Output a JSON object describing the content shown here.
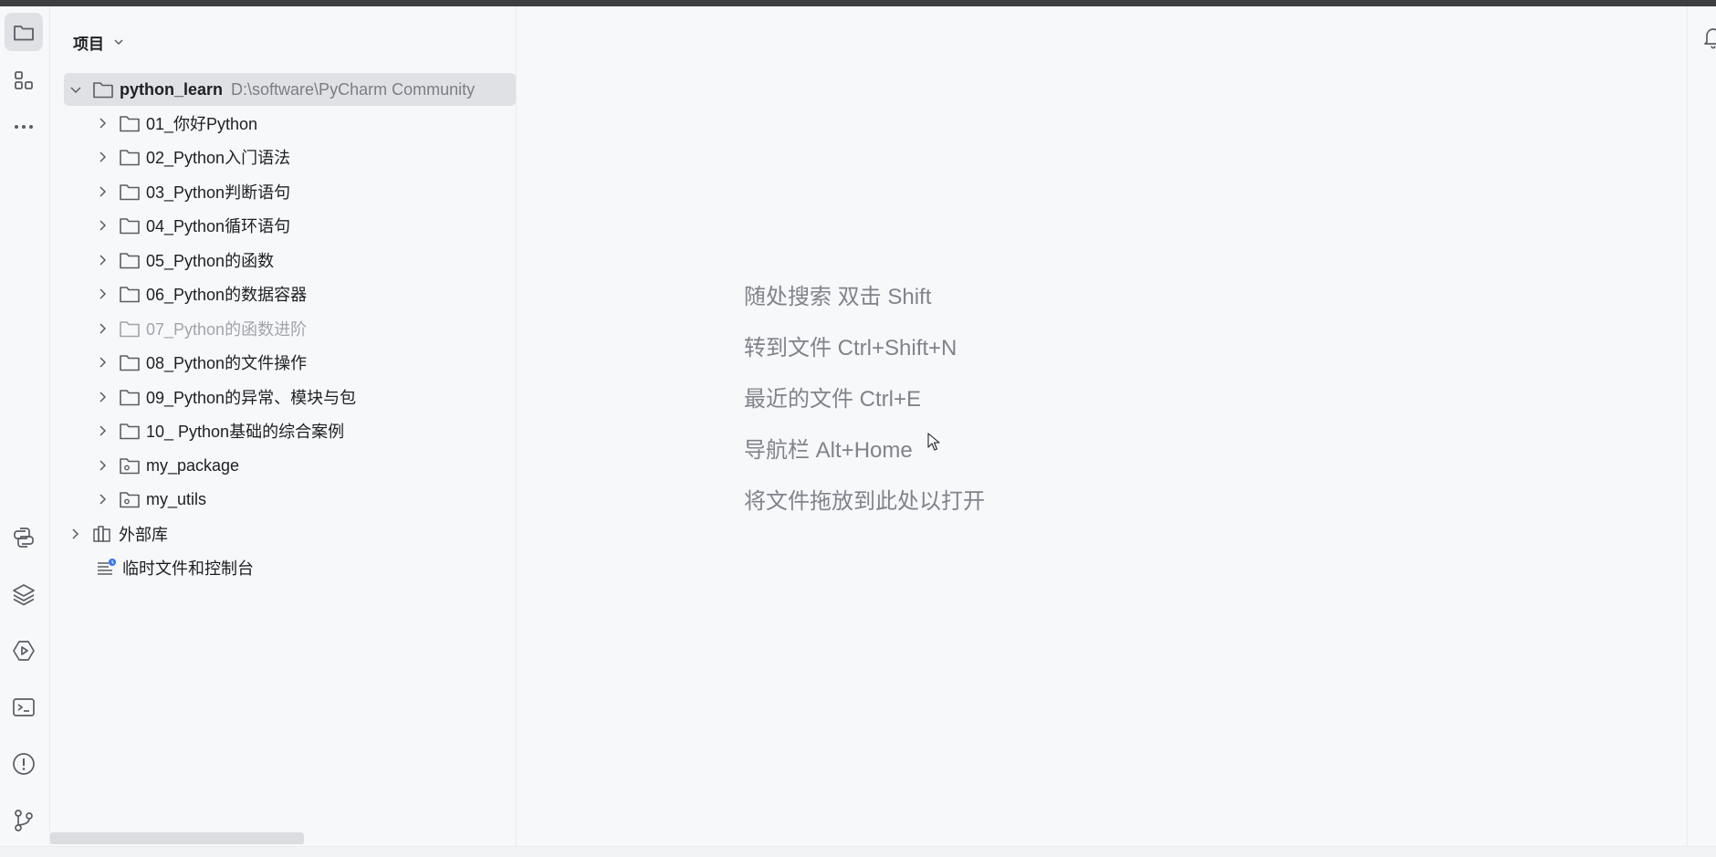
{
  "panel": {
    "title": "项目"
  },
  "tree": {
    "root": {
      "name": "python_learn",
      "path": "D:\\software\\PyCharm Community"
    },
    "folders": [
      {
        "label": "01_你好Python",
        "dimmed": false
      },
      {
        "label": "02_Python入门语法",
        "dimmed": false
      },
      {
        "label": "03_Python判断语句",
        "dimmed": false
      },
      {
        "label": "04_Python循环语句",
        "dimmed": false
      },
      {
        "label": "05_Python的函数",
        "dimmed": false
      },
      {
        "label": "06_Python的数据容器",
        "dimmed": false
      },
      {
        "label": "07_Python的函数进阶",
        "dimmed": true
      },
      {
        "label": "08_Python的文件操作",
        "dimmed": false
      },
      {
        "label": "09_Python的异常、模块与包",
        "dimmed": false
      },
      {
        "label": "10_ Python基础的综合案例",
        "dimmed": false
      }
    ],
    "packages": [
      {
        "label": "my_package"
      },
      {
        "label": "my_utils"
      }
    ],
    "external_libraries": "外部库",
    "scratches": "临时文件和控制台"
  },
  "editor_hints": [
    "随处搜索 双击 Shift",
    "转到文件 Ctrl+Shift+N",
    "最近的文件 Ctrl+E",
    "导航栏 Alt+Home",
    "将文件拖放到此处以打开"
  ],
  "toolbar_icons": {
    "left_top": [
      "project-icon",
      "structure-icon",
      "more-icon"
    ],
    "left_bottom": [
      "python-console-icon",
      "layers-icon",
      "services-icon",
      "terminal-icon",
      "problems-icon",
      "git-icon"
    ],
    "right": [
      "notifications-icon"
    ]
  },
  "colors": {
    "background": "#f7f8fa",
    "selection": "#dfe1e5",
    "hint_text": "#80838a",
    "dim_text": "#a1a4aa",
    "badge_blue": "#3574f0"
  }
}
